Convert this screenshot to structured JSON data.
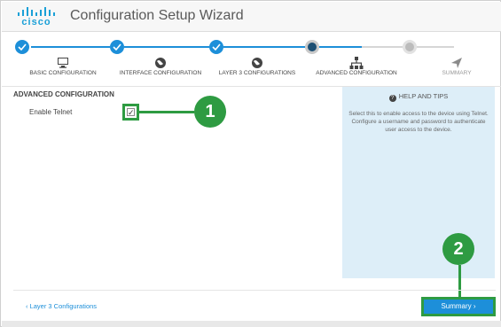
{
  "app": {
    "logo_text": "cisco",
    "title": "Configuration Setup Wizard"
  },
  "steps": [
    {
      "label": "BASIC CONFIGURATION",
      "state": "done",
      "icon": "monitor-icon"
    },
    {
      "label": "INTERFACE CONFIGURATION",
      "state": "done",
      "icon": "globe-icon"
    },
    {
      "label": "LAYER 3 CONFIGURATIONS",
      "state": "done",
      "icon": "globe-icon"
    },
    {
      "label": "ADVANCED CONFIGURATION",
      "state": "current",
      "icon": "network-icon"
    },
    {
      "label": "SUMMARY",
      "state": "future",
      "icon": "send-icon"
    }
  ],
  "main": {
    "section_title": "ADVANCED CONFIGURATION",
    "enable_telnet_label": "Enable Telnet",
    "enable_telnet_checked": true
  },
  "help": {
    "title": "HELP AND TIPS",
    "body": "Select this to enable access to the device using Telnet. Configure a username and password to authenticate user access to the device."
  },
  "footer": {
    "back_label": "‹ Layer 3 Configurations",
    "next_label": "Summary ›"
  },
  "callouts": {
    "first": "1",
    "second": "2"
  },
  "colors": {
    "accent": "#1d8fd9",
    "callout_green": "#2e9b42",
    "current_step": "#1d4f73",
    "help_bg": "#ddeef8"
  }
}
